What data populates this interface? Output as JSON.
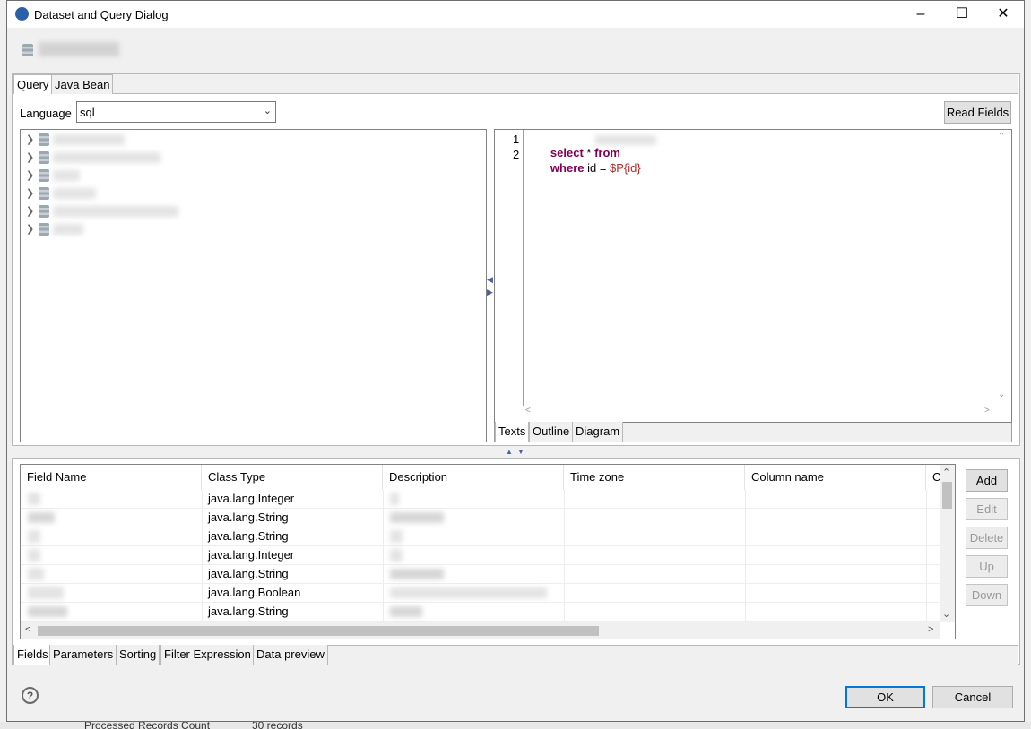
{
  "dialog": {
    "title": "Dataset and Query Dialog",
    "window_controls": [
      "minimize-icon",
      "maximize-icon",
      "close-icon"
    ]
  },
  "top_tabs": [
    "Query",
    "Java Bean"
  ],
  "language": {
    "label": "Language",
    "value": "sql"
  },
  "read_fields_label": "Read Fields",
  "editor": {
    "lines": [
      {
        "num": "1",
        "kw1": "select",
        "rest1": " * ",
        "kw2": "from",
        "rest2": ""
      },
      {
        "num": "2",
        "kw1": "where",
        "rest1": " id = ",
        "kw2": "",
        "param": "$P{id}"
      }
    ],
    "tabs": [
      "Texts",
      "Outline",
      "Diagram"
    ]
  },
  "fields_table": {
    "headers": [
      "Field Name",
      "Class Type",
      "Description",
      "Time zone",
      "Column name",
      "C"
    ],
    "rows": [
      {
        "class_type": "java.lang.Integer"
      },
      {
        "class_type": "java.lang.String"
      },
      {
        "class_type": "java.lang.String"
      },
      {
        "class_type": "java.lang.Integer"
      },
      {
        "class_type": "java.lang.String"
      },
      {
        "class_type": "java.lang.Boolean"
      },
      {
        "class_type": "java.lang.String"
      }
    ],
    "buttons": {
      "add": "Add",
      "edit": "Edit",
      "delete": "Delete",
      "up": "Up",
      "down": "Down"
    }
  },
  "bottom_tabs": [
    "Fields",
    "Parameters",
    "Sorting",
    "Filter Expression",
    "Data preview"
  ],
  "footer": {
    "ok": "OK",
    "cancel": "Cancel"
  },
  "background": {
    "label": "Processed Records Count",
    "value": "30 records"
  }
}
